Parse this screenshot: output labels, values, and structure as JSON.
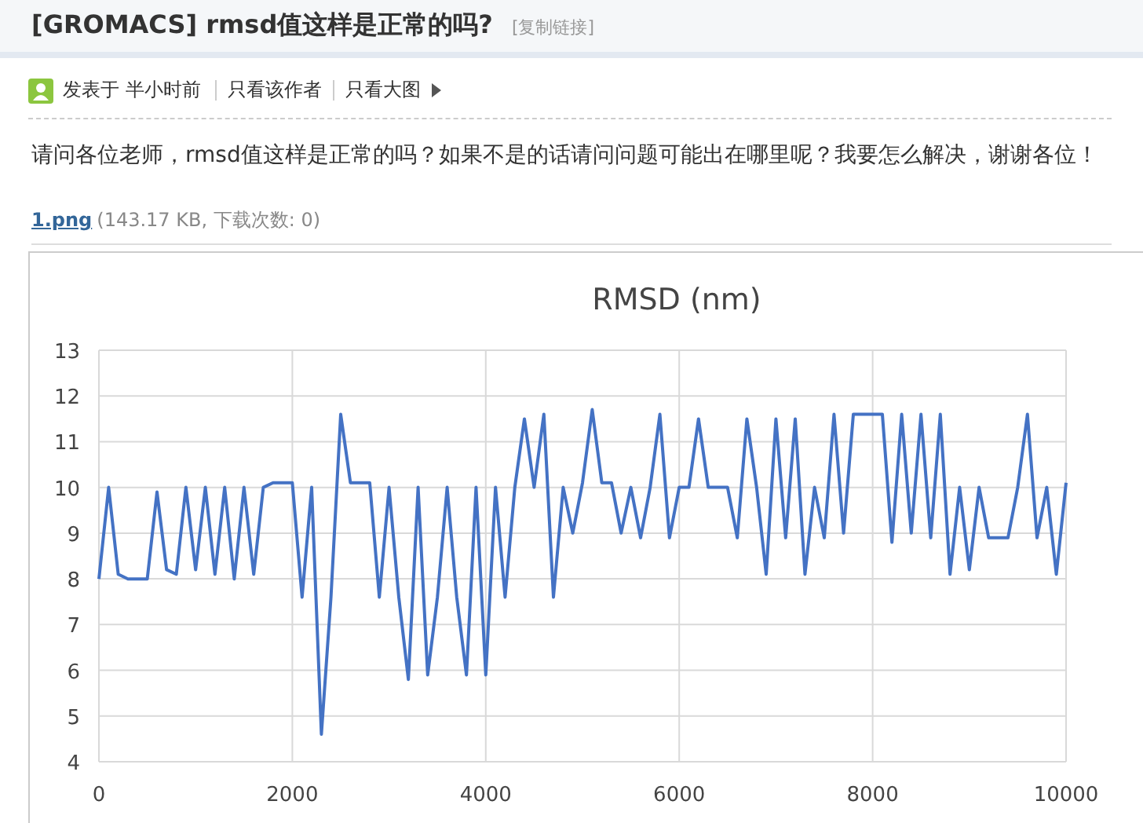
{
  "post": {
    "title": "[GROMACS] rmsd值这样是正常的吗?",
    "copy_link": "[复制链接]"
  },
  "meta": {
    "posted": "发表于",
    "time": "半小时前",
    "links": [
      "只看该作者",
      "只看大图"
    ]
  },
  "body": "请问各位老师，rmsd值这样是正常的吗？如果不是的话请问问题可能出在哪里呢？我要怎么解决，谢谢各位！",
  "attachment": {
    "name": "1.png",
    "info": "(143.17 KB, 下载次数: 0)"
  },
  "chart_data": {
    "type": "line",
    "grid": true,
    "title": "RMSD (nm)",
    "xlim": [
      0,
      10000
    ],
    "ylim": [
      4,
      13
    ],
    "xticks": [
      0,
      2000,
      4000,
      6000,
      8000,
      10000
    ],
    "yticks": [
      4,
      5,
      6,
      7,
      8,
      9,
      10,
      11,
      12,
      13
    ],
    "x": [
      0,
      100,
      200,
      300,
      400,
      500,
      600,
      700,
      800,
      900,
      1000,
      1100,
      1200,
      1300,
      1400,
      1500,
      1600,
      1700,
      1800,
      1900,
      2000,
      2100,
      2200,
      2300,
      2400,
      2500,
      2600,
      2700,
      2800,
      2900,
      3000,
      3100,
      3200,
      3300,
      3400,
      3500,
      3600,
      3700,
      3800,
      3900,
      4000,
      4100,
      4200,
      4300,
      4400,
      4500,
      4600,
      4700,
      4800,
      4900,
      5000,
      5100,
      5200,
      5300,
      5400,
      5500,
      5600,
      5700,
      5800,
      5900,
      6000,
      6100,
      6200,
      6300,
      6400,
      6500,
      6600,
      6700,
      6800,
      6900,
      7000,
      7100,
      7200,
      7300,
      7400,
      7500,
      7600,
      7700,
      7800,
      7900,
      8000,
      8100,
      8200,
      8300,
      8400,
      8500,
      8600,
      8700,
      8800,
      8900,
      9000,
      9100,
      9200,
      9300,
      9400,
      9500,
      9600,
      9700,
      9800,
      9900,
      10000
    ],
    "series": [
      {
        "color": "#4472c4",
        "values": [
          8,
          10,
          8.1,
          8,
          8,
          8,
          9.9,
          8.2,
          8.1,
          10,
          8.2,
          10,
          8.1,
          10,
          8,
          10,
          8.1,
          10,
          10.1,
          10.1,
          10.1,
          7.6,
          10,
          4.6,
          7.6,
          11.6,
          10.1,
          10.1,
          10.1,
          7.6,
          10,
          7.6,
          5.8,
          10,
          5.9,
          7.6,
          10,
          7.6,
          5.9,
          10,
          5.9,
          10,
          7.6,
          10,
          11.5,
          10,
          11.6,
          7.6,
          10,
          9,
          10.1,
          11.7,
          10.1,
          10.1,
          9,
          10,
          8.9,
          10,
          11.6,
          8.9,
          10,
          10,
          11.5,
          10,
          10,
          10,
          8.9,
          11.5,
          10,
          8.1,
          11.5,
          8.9,
          11.5,
          8.1,
          10,
          8.9,
          11.6,
          9,
          11.6,
          11.6,
          11.6,
          11.6,
          8.8,
          11.6,
          9,
          11.6,
          8.9,
          11.6,
          8.1,
          10,
          8.2,
          10,
          8.9,
          8.9,
          8.9,
          10,
          11.6,
          8.9,
          10,
          8.1,
          10.1
        ]
      }
    ]
  }
}
